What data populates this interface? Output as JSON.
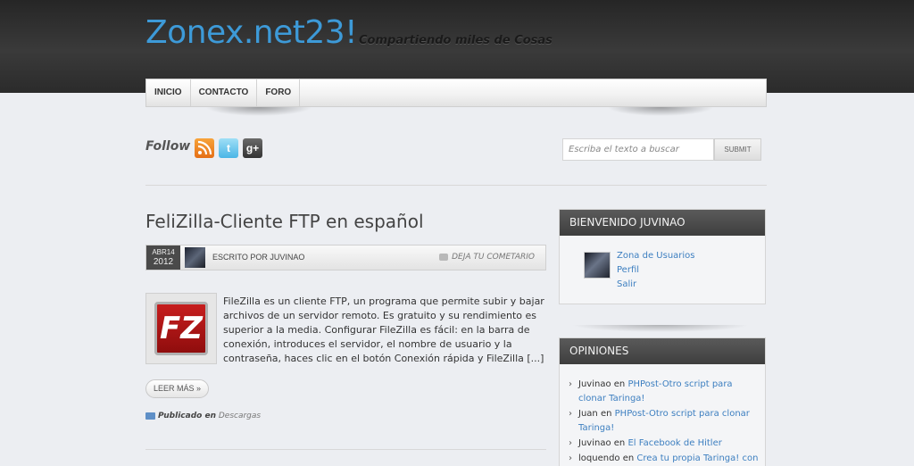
{
  "site": {
    "title": "Zonex.net23!",
    "tagline": "Compartiendo miles de Cosas"
  },
  "nav": {
    "items": [
      {
        "label": "INICIO"
      },
      {
        "label": "CONTACTO"
      },
      {
        "label": "FORO"
      }
    ]
  },
  "follow": {
    "label": "Follow",
    "icons": [
      "rss-icon",
      "twitter-icon",
      "google-plus-icon"
    ],
    "twitter_glyph": "t",
    "gplus_glyph": "g+"
  },
  "search": {
    "placeholder": "Escriba el texto a buscar",
    "button_label": "SUBMIT"
  },
  "post": {
    "title": "FeliZilla-Cliente FTP en español",
    "date_month": "ABR14",
    "date_year": "2012",
    "author": "ESCRITO POR JUVINAO",
    "comment_link": "DEJA TU COMETARIO",
    "logo_text": "FZ",
    "excerpt": "FileZilla es un cliente FTP, un programa que permite subir y bajar archivos de un servidor remoto. Es gratuito y su rendimiento es superior a la media. Configurar FileZilla es fácil: en la barra de conexión, introduces el servidor, el nombre de usuario y la contraseña, haces clic en el botón Conexión rápida y FileZilla [...]",
    "read_more": "LEER MÁS »",
    "published_label": "Publicado en",
    "category": "Descargas"
  },
  "welcome_widget": {
    "title": "BIENVENIDO JUVINAO",
    "links": [
      "Zona de Usuarios",
      "Perfil",
      "Salir"
    ]
  },
  "opinions_widget": {
    "title": "OPINIONES",
    "items": [
      {
        "author": "Juvinao",
        "sep": "en",
        "link": "PHPost-Otro script para clonar Taringa!"
      },
      {
        "author": "Juan",
        "sep": "en",
        "link": "PHPost-Otro script para clonar Taringa!"
      },
      {
        "author": "Juvinao",
        "sep": "en",
        "link": "El Facebook de Hitler"
      },
      {
        "author": "loquendo",
        "sep": "en",
        "link": "Crea tu propia Taringa! con"
      }
    ]
  },
  "colors": {
    "accent": "#3d9ad8",
    "link": "#3d7fc0",
    "header_bg": "#2e2e2e",
    "widget_head": "#4a4a4a"
  }
}
